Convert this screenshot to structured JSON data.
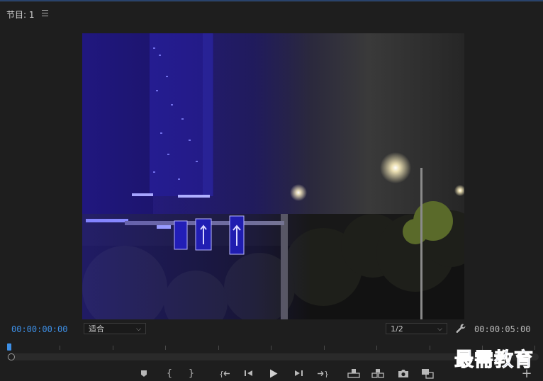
{
  "panel": {
    "tab_title": "节目: 1"
  },
  "viewer": {
    "timecode_current": "00:00:00:00",
    "fit_select": {
      "value": "适合"
    },
    "resolution_select": {
      "value": "1/2"
    },
    "timecode_duration": "00:00:05:00"
  },
  "controls": {
    "mark_in_glyph": "{",
    "mark_out_glyph": "}",
    "add": "+"
  },
  "watermark": "最需教育",
  "colors": {
    "accent_blue": "#3d8fe6",
    "panel_bg": "#1e1e1e",
    "watermark_blue": "#1a3fa5"
  }
}
